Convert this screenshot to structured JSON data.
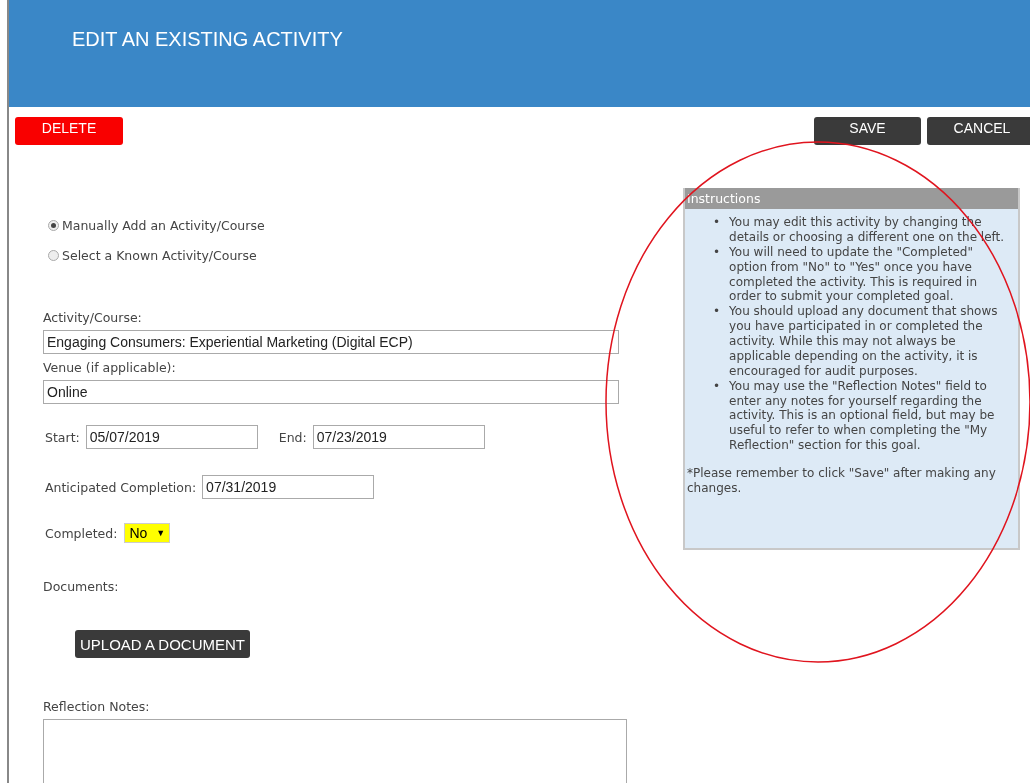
{
  "header": {
    "title": "EDIT AN EXISTING ACTIVITY"
  },
  "actions": {
    "delete": "DELETE",
    "save": "SAVE",
    "cancel": "CANCEL"
  },
  "source_options": [
    {
      "label": "Manually Add an Activity/Course",
      "selected": true
    },
    {
      "label": "Select a Known Activity/Course",
      "selected": false
    }
  ],
  "activity": {
    "label": "Activity/Course:",
    "value": "Engaging Consumers: Experiential Marketing (Digital ECP)"
  },
  "venue": {
    "label": "Venue (if applicable):",
    "value": "Online"
  },
  "start": {
    "label": "Start:",
    "value": "05/07/2019"
  },
  "end": {
    "label": "End:",
    "value": "07/23/2019"
  },
  "anticipated": {
    "label": "Anticipated Completion:",
    "value": "07/31/2019"
  },
  "completed": {
    "label": "Completed:",
    "value": "No",
    "arrow": "▼"
  },
  "documents": {
    "label": "Documents:",
    "button": "UPLOAD A DOCUMENT"
  },
  "reflection": {
    "label": "Reflection Notes:"
  },
  "instructions": {
    "title": "Instructions",
    "items": [
      {
        "bullet": "•",
        "text": "You may edit this activity by changing the details or choosing a different one on the left."
      },
      {
        "bullet": "•",
        "text": "You will need to update the \"Completed\" option from \"No\" to \"Yes\" once you have completed the activity. This is required in order to submit your completed goal."
      },
      {
        "bullet": "•",
        "text": "You should upload any document that shows you have participated in or completed the activity. While this may not always be applicable depending on the activity, it is encouraged for audit purposes."
      },
      {
        "bullet": "•",
        "text": "You may use the \"Reflection Notes\" field to enter any notes for yourself regarding the activity. This is an optional field, but may be useful to refer to when completing the \"My Reflection\" section for this goal."
      }
    ],
    "note": "*Please remember to click \"Save\" after making any changes."
  }
}
